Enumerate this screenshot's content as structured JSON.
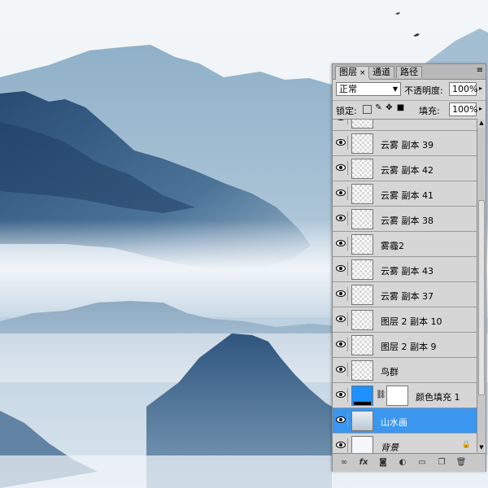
{
  "panel": {
    "tabs": [
      {
        "label": "图层",
        "close": "×",
        "active": true
      },
      {
        "label": "通道",
        "active": false
      },
      {
        "label": "路径",
        "active": false
      }
    ],
    "blend_mode": "正常",
    "opacity_label": "不透明度:",
    "opacity_value": "100%",
    "lock_label": "锁定:",
    "fill_label": "填充:",
    "fill_value": "100%",
    "layers": [
      {
        "name": "云雾 副本 39"
      },
      {
        "name": "云雾 副本 42"
      },
      {
        "name": "云雾 副本 41"
      },
      {
        "name": "云雾 副本 38"
      },
      {
        "name": "雾霾2"
      },
      {
        "name": "云雾 副本 43"
      },
      {
        "name": "云雾 副本 37"
      },
      {
        "name": "图层 2 副本 10"
      },
      {
        "name": "图层 2 副本 9"
      },
      {
        "name": "鸟群"
      },
      {
        "name": "颜色填充 1"
      },
      {
        "name": "山水画"
      },
      {
        "name": "背景"
      }
    ],
    "colors": {
      "fill_layer": "#1e90ff",
      "selected": "#3a96ee"
    }
  }
}
